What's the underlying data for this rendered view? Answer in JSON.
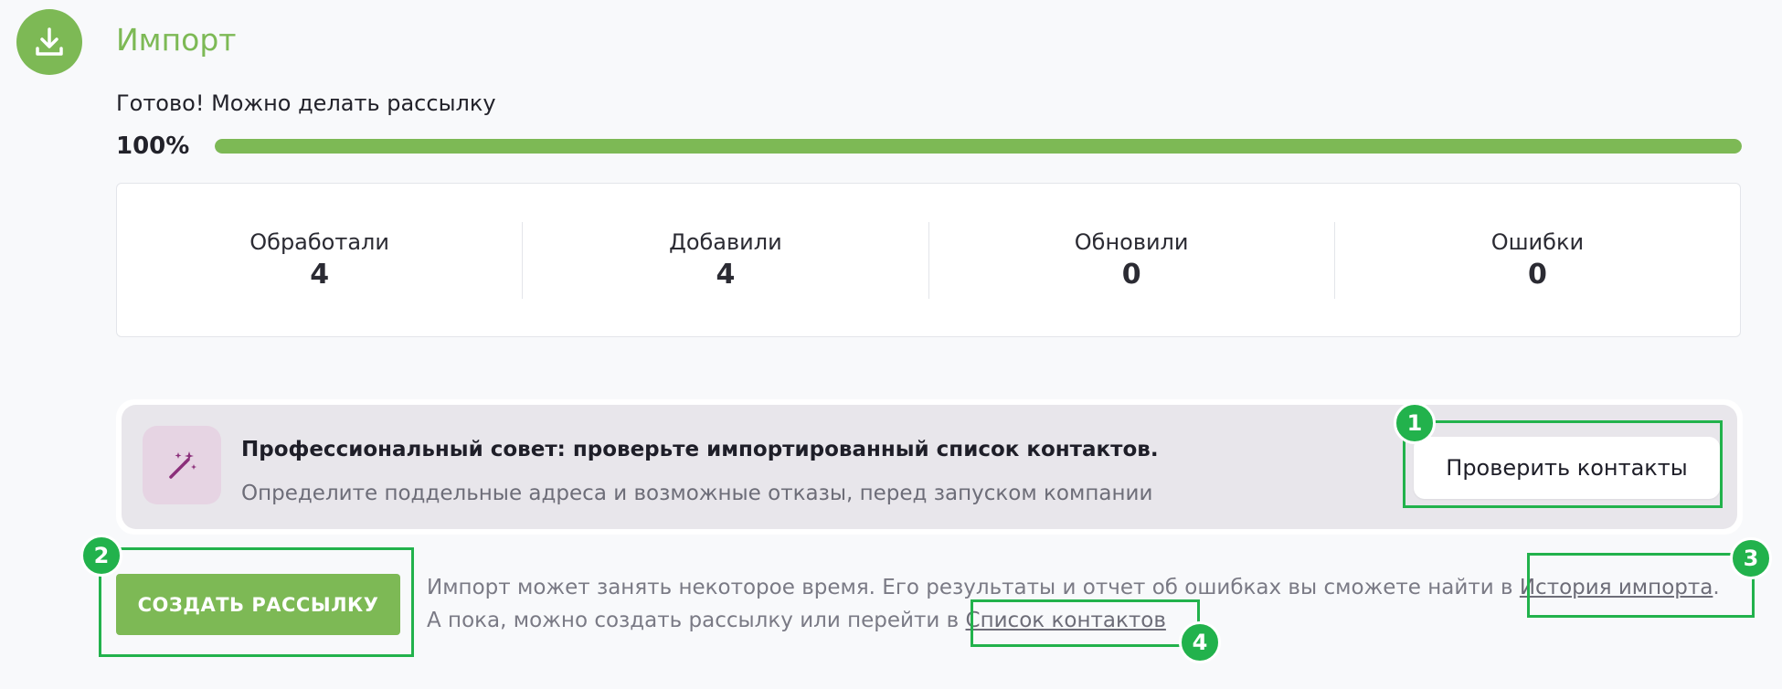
{
  "header": {
    "title": "Импорт",
    "icon": "download-icon"
  },
  "status": {
    "message": "Готово! Можно делать рассылку",
    "progress_label": "100%",
    "progress": 1.0
  },
  "stats": [
    {
      "label": "Обработали",
      "value": "4"
    },
    {
      "label": "Добавили",
      "value": "4"
    },
    {
      "label": "Обновили",
      "value": "0"
    },
    {
      "label": "Ошибки",
      "value": "0"
    }
  ],
  "tip": {
    "icon": "magic-wand-icon",
    "title": "Профессиональный совет: проверьте импортированный список контактов.",
    "description": "Определите поддельные адреса и возможные отказы, перед запуском компании",
    "button_label": "Проверить контакты"
  },
  "actions": {
    "create_label": "СОЗДАТЬ РАССЫЛКУ",
    "info_line1": "Импорт может занять некоторое время. Его результаты и отчет об ошибках вы сможете найти в ",
    "history_link": "История импорта",
    "info_line1_end": ".",
    "info_line2": "А пока, можно создать рассылку или перейти в ",
    "contacts_link": "Список контактов"
  },
  "annotations": {
    "badge_1": "1",
    "badge_2": "2",
    "badge_3": "3",
    "badge_4": "4",
    "color": "#22b24c"
  },
  "colors": {
    "accent": "#7db955",
    "tip_bg": "#e8e6eb",
    "tip_icon_bg": "#e6d4e3",
    "tip_icon": "#8b2f7a"
  }
}
